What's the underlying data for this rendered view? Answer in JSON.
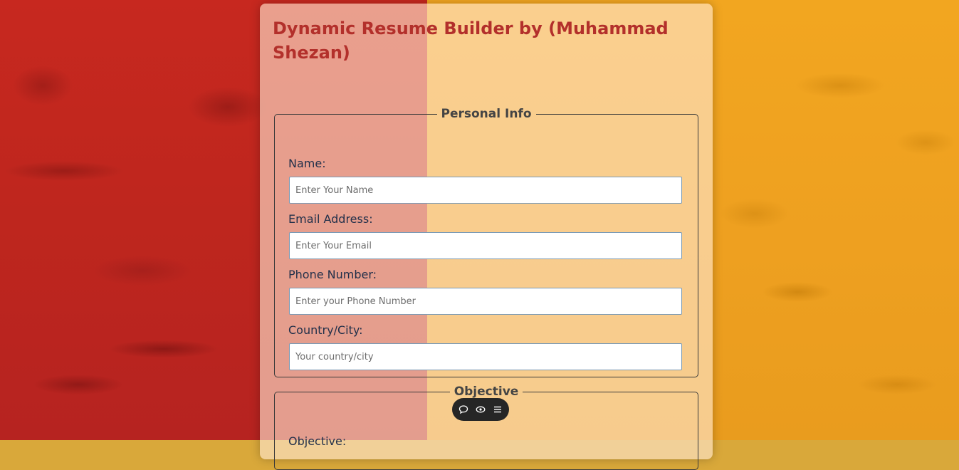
{
  "app": {
    "title": "Dynamic Resume Builder by (Muhammad Shezan)"
  },
  "personal_info": {
    "legend": "Personal Info",
    "fields": [
      {
        "label": "Name:",
        "placeholder": "Enter Your Name",
        "value": ""
      },
      {
        "label": "Email Address:",
        "placeholder": "Enter Your Email",
        "value": ""
      },
      {
        "label": "Phone Number:",
        "placeholder": "Enter your Phone Number",
        "value": ""
      },
      {
        "label": "Country/City:",
        "placeholder": "Your country/city",
        "value": ""
      }
    ]
  },
  "objective": {
    "legend": "Objective",
    "field_label": "Objective:"
  },
  "floating_toolbar": {
    "icons": [
      "comment-icon",
      "eye-icon",
      "menu-icon"
    ]
  },
  "colors": {
    "title": "#b3302b",
    "background_left": "#c7281f",
    "background_right": "#f2a620",
    "toolbar": "#262626"
  }
}
